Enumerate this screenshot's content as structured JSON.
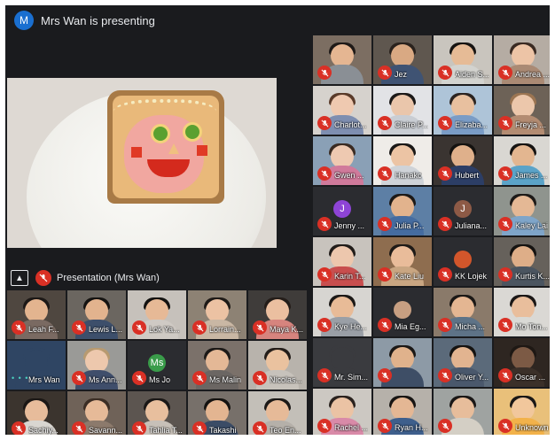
{
  "header": {
    "avatar_letter": "M",
    "title": "Mrs Wan is presenting"
  },
  "presentation": {
    "label": "Presentation (Mrs Wan)"
  },
  "right_grid": [
    {
      "name": "",
      "bg": "#7c6e62",
      "skin": "#e5b692",
      "shirt": "#8a8f95",
      "hair": "#1f1a18"
    },
    {
      "name": "Jez",
      "bg": "#5f574f",
      "skin": "#d9a983",
      "shirt": "#3f5373",
      "hair": "#2a221d"
    },
    {
      "name": "Aiden S...",
      "bg": "#c9c5be",
      "skin": "#e6bb96",
      "shirt": "#d3d3cf",
      "hair": "#161412"
    },
    {
      "name": "Andrea ...",
      "bg": "#b5aca3",
      "skin": "#edc4a6",
      "shirt": "#aa8a74",
      "hair": "#3a2a22"
    },
    {
      "name": "Charlot...",
      "bg": "#d6d2cd",
      "skin": "#efc9b0",
      "shirt": "#7e8eb0",
      "hair": "#5a3b2a"
    },
    {
      "name": "Claire P...",
      "bg": "#e2e3e6",
      "skin": "#eac6ab",
      "shirt": "#c9cdd3",
      "hair": "#1b1918"
    },
    {
      "name": "Elizaba...",
      "bg": "#aec4d8",
      "skin": "#e8c09f",
      "shirt": "#7a9cc6",
      "hair": "#2b2320"
    },
    {
      "name": "Freyja ...",
      "bg": "#6d6257",
      "skin": "#ecc7ab",
      "shirt": "#b38c72",
      "hair": "#9b7552"
    },
    {
      "name": "Gwen ...",
      "bg": "#8aa0b6",
      "skin": "#eec9b1",
      "shirt": "#d07a9b",
      "hair": "#3a2b22"
    },
    {
      "name": "Hanako",
      "bg": "#efece8",
      "skin": "#ecc4a4",
      "shirt": "#cfd3d8",
      "hair": "#1a1817"
    },
    {
      "name": "Hubert",
      "bg": "#3a3431",
      "skin": "#dfb08b",
      "shirt": "#2c3e66",
      "hair": "#141210"
    },
    {
      "name": "James ...",
      "bg": "#d9d7d2",
      "skin": "#e3b690",
      "shirt": "#5ba3c8",
      "hair": "#161412"
    },
    {
      "name": "Jenny ...",
      "bg": "#2b2c30",
      "letter": "J",
      "letter_color": "#8e44d6"
    },
    {
      "name": "Julia P...",
      "bg": "#5d7fa5",
      "skin": "#e2b38d",
      "shirt": "#456ca0",
      "hair": "#1c1917"
    },
    {
      "name": "Juliana...",
      "bg": "#2b2c30",
      "letter": "J",
      "letter_color": "#8d5a46"
    },
    {
      "name": "Kaley Lai",
      "bg": "#8f948e",
      "skin": "#e4b895",
      "shirt": "#7fa5c9",
      "hair": "#1d1a18"
    },
    {
      "name": "Karin T...",
      "bg": "#c8c3bd",
      "skin": "#edc7ad",
      "shirt": "#c84e4e",
      "hair": "#211c19"
    },
    {
      "name": "Kate Liu",
      "bg": "#8e6d4f",
      "skin": "#e9bc9a",
      "shirt": "#c9a682",
      "hair": "#1e1a17"
    },
    {
      "name": "KK Lojek",
      "bg": "#2b2c30",
      "letter": "",
      "letter_color": "#d2562b"
    },
    {
      "name": "Kurtis K...",
      "bg": "#66615b",
      "skin": "#deae88",
      "shirt": "#4b5560",
      "hair": "#151311"
    },
    {
      "name": "Kye He...",
      "bg": "#d7d5d1",
      "skin": "#e8bb97",
      "shirt": "#9a9fa6",
      "hair": "#1b1816"
    },
    {
      "name": "Mia Eg...",
      "bg": "#2b2c30",
      "letter": "",
      "letter_color": "#c79f82"
    },
    {
      "name": "Micha ...",
      "bg": "#8a7a6a",
      "skin": "#e4b692",
      "shirt": "#5e7387",
      "hair": "#1b1816"
    },
    {
      "name": "Mo Ton...",
      "bg": "#dad8d4",
      "skin": "#e9be9c",
      "shirt": "#d9d9d5",
      "hair": "#1a1716"
    },
    {
      "name": "Mr. Sim...",
      "bg": "#3a3b3f",
      "skin": "#3a3b3f",
      "shirt": "#3a3b3f",
      "hair": "#3a3b3f"
    },
    {
      "name": "",
      "bg": "#8d9aa6",
      "skin": "#e0b28c",
      "shirt": "#3e4e66",
      "hair": "#1b1816"
    },
    {
      "name": "Oliver Y...",
      "bg": "#5b6a7a",
      "skin": "#e2b490",
      "shirt": "#4a586c",
      "hair": "#151311"
    },
    {
      "name": "Oscar ...",
      "bg": "#2e2621",
      "skin": "#7c5a45",
      "shirt": "#3b3029",
      "hair": "#1e1814"
    },
    {
      "name": "Rachel ...",
      "bg": "#ccc8c2",
      "skin": "#ebc3a4",
      "shirt": "#d98aa8",
      "hair": "#2a221e"
    },
    {
      "name": "Ryan H...",
      "bg": "#b6b1aa",
      "skin": "#e4b794",
      "shirt": "#3e5f8c",
      "hair": "#181513"
    },
    {
      "name": "",
      "bg": "#9fa3a1",
      "skin": "#e7bd9b",
      "shirt": "#d4cfc5",
      "hair": "#1a1716"
    },
    {
      "name": "Unknown",
      "bg": "#e9c07a",
      "skin": "#f1c79c",
      "shirt": "#f2b24a",
      "hair": "#1a1716"
    }
  ],
  "left_grid": [
    {
      "name": "Leah F...",
      "bg": "#4f4740",
      "skin": "#e3b48f",
      "shirt": "#7a6a62",
      "hair": "#1c1816"
    },
    {
      "name": "Lewis L...",
      "bg": "#6b6660",
      "skin": "#e2b38e",
      "shirt": "#3d4f6b",
      "hair": "#151311"
    },
    {
      "name": "Lok Ya...",
      "bg": "#c6c1bb",
      "skin": "#e6b996",
      "shirt": "#cfcac4",
      "hair": "#121110"
    },
    {
      "name": "Lorrain...",
      "bg": "#8d8274",
      "skin": "#ecc2a3",
      "shirt": "#c9b7a4",
      "hair": "#1e1a17"
    },
    {
      "name": "Maya K...",
      "bg": "#3f3c3a",
      "skin": "#ebbfa0",
      "shirt": "#d6847e",
      "hair": "#241d19"
    },
    {
      "name": "Mrs Wan",
      "bg": "#2f4563",
      "skin": "#2f4563",
      "shirt": "#2f4563",
      "hair": "#2f4563",
      "dots": "• • •"
    },
    {
      "name": "Ms Ann...",
      "bg": "#9a9a97",
      "skin": "#edc8ad",
      "shirt": "#3f4e6b",
      "hair": "#b89a70"
    },
    {
      "name": "Ms Jo",
      "bg": "#2b2c30",
      "letter": "Ms",
      "letter_color": "#3a9c4a"
    },
    {
      "name": "Ms Malin",
      "bg": "#7b716a",
      "skin": "#e4b896",
      "shirt": "#6b6663",
      "hair": "#1c1917"
    },
    {
      "name": "Nicolas...",
      "bg": "#b8b3ac",
      "skin": "#eac29f",
      "shirt": "#c7c2bb",
      "hair": "#231d19"
    },
    {
      "name": "Sachiy...",
      "bg": "#3b342e",
      "skin": "#e7bc9b",
      "shirt": "#d9d6d1",
      "hair": "#1b1715"
    },
    {
      "name": "Savann...",
      "bg": "#6f6258",
      "skin": "#e6ba98",
      "shirt": "#8c7a6c",
      "hair": "#3b2d24"
    },
    {
      "name": "Tahlia T...",
      "bg": "#5c5550",
      "skin": "#e8bf9e",
      "shirt": "#c7c0b8",
      "hair": "#1a1716"
    },
    {
      "name": "Takashi",
      "bg": "#77706a",
      "skin": "#e3b591",
      "shirt": "#3b4c66",
      "hair": "#141210"
    },
    {
      "name": "Teo En...",
      "bg": "#c3bfb8",
      "skin": "#e6ba98",
      "shirt": "#b5b0a9",
      "hair": "#1b1816"
    }
  ]
}
